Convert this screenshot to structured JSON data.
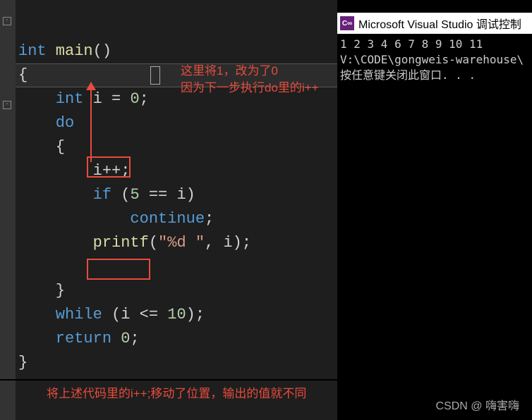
{
  "code": {
    "line1_kw": "int",
    "line1_fn": " main",
    "line1_p": "()",
    "line2": "{",
    "line3_kw": "    int",
    "line3_rest": " i = ",
    "line3_num": "0",
    "line3_semi": ";",
    "line4_kw": "    do",
    "line5": "    {",
    "line6_id": "        i",
    "line6_op": "++;",
    "line7_kw": "        if",
    "line7_p1": " (",
    "line7_num": "5",
    "line7_op": " == ",
    "line7_id": "i",
    "line7_p2": ")",
    "line8_kw": "            continue",
    "line8_semi": ";",
    "line9_fn": "        printf",
    "line9_p1": "(",
    "line9_str": "\"%d \"",
    "line9_c": ", ",
    "line9_id": "i",
    "line9_p2": ");",
    "line10": "",
    "line11": "    }",
    "line12_kw": "    while",
    "line12_p1": " (",
    "line12_id": "i",
    "line12_op": " <= ",
    "line12_num": "10",
    "line12_p2": ");",
    "line13_kw": "    return",
    "line13_num": " 0",
    "line13_semi": ";",
    "line14": "}"
  },
  "annotations": {
    "top1": "这里将1，改为了0",
    "top2": "因为下一步执行do里的i++",
    "bottom": "将上述代码里的i++;移动了位置，输出的值就不同"
  },
  "console": {
    "title": "Microsoft Visual Studio 调试控制",
    "output": "1 2 3 4 6 7 8 9 10 11",
    "path": "V:\\CODE\\gongweis-warehouse\\",
    "prompt": "按任意键关闭此窗口. . ."
  },
  "watermark": "CSDN @  嗨害嗨"
}
